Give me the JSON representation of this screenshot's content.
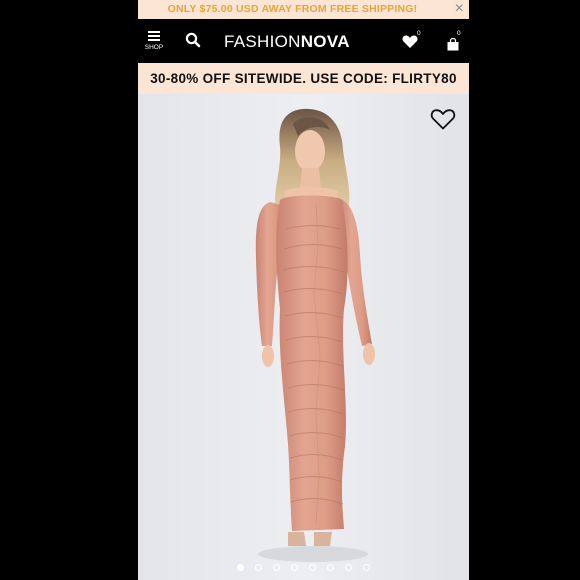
{
  "shipping_bar": {
    "text": "ONLY $75.00 USD AWAY FROM FREE SHIPPING!",
    "close_icon": "close-icon",
    "color": "#e8a33b"
  },
  "header": {
    "menu_label": "SHOP",
    "logo_part1": "FASHION",
    "logo_part2": "NOVA",
    "wishlist_count": "0",
    "cart_count": "0"
  },
  "promo_bar": {
    "text": "30-80% OFF SITEWIDE. USE CODE: FLIRTY80"
  },
  "product": {
    "image_count": 8,
    "active_image": 1,
    "dress_color": "#dd9c86",
    "background": "#e7e8ec"
  }
}
